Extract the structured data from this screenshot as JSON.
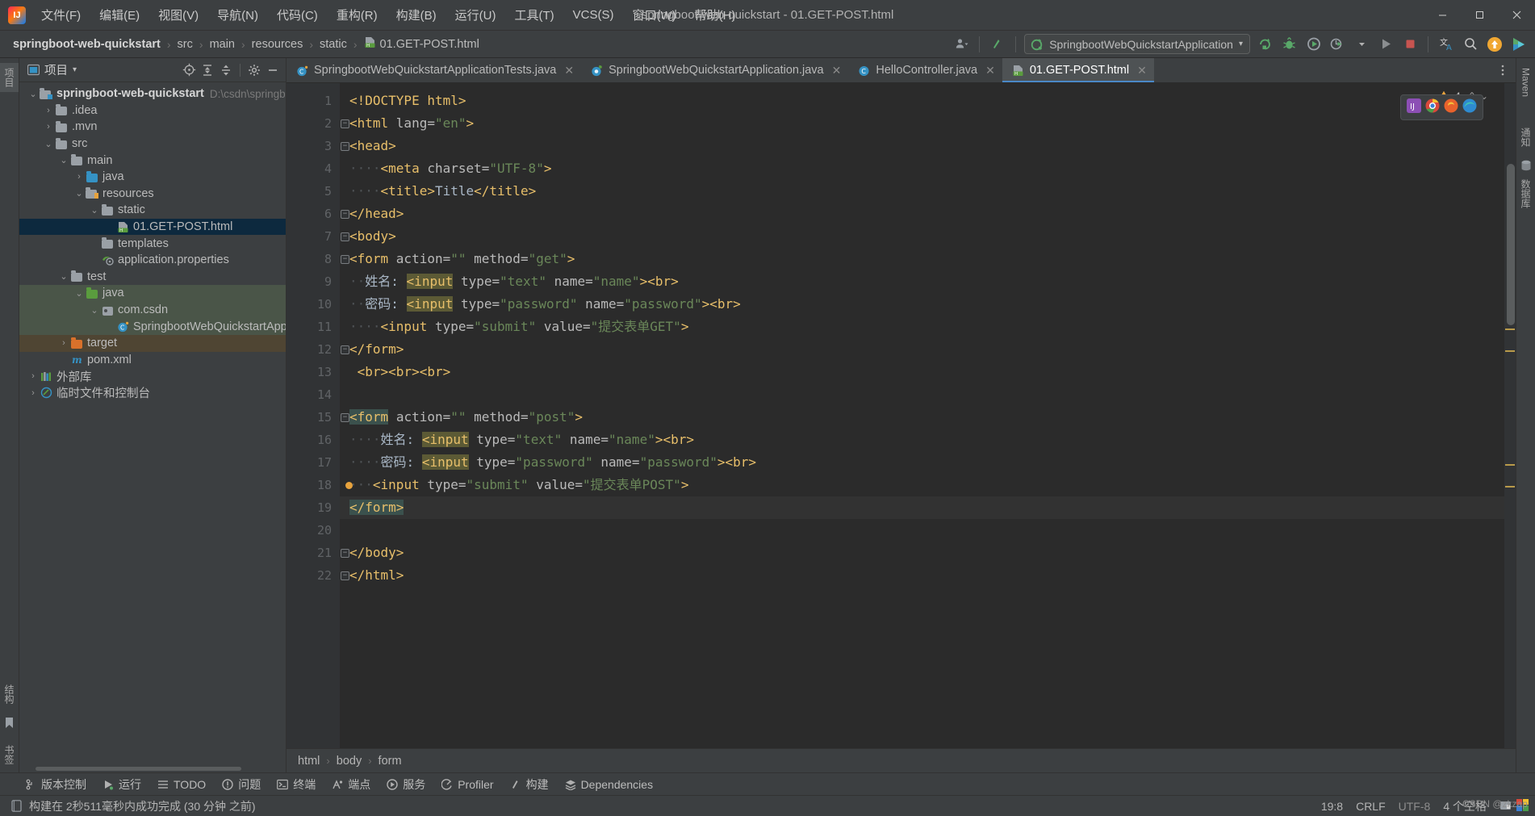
{
  "window": {
    "title": "springboot-web-quickstart - 01.GET-POST.html",
    "logo_text": "IJ",
    "controls": {
      "minimize": "—",
      "maximize": "☐",
      "close": "✕"
    }
  },
  "menubar": {
    "items": [
      {
        "label": "文件(F)",
        "name": "menu-file"
      },
      {
        "label": "编辑(E)",
        "name": "menu-edit"
      },
      {
        "label": "视图(V)",
        "name": "menu-view"
      },
      {
        "label": "导航(N)",
        "name": "menu-navigate"
      },
      {
        "label": "代码(C)",
        "name": "menu-code"
      },
      {
        "label": "重构(R)",
        "name": "menu-refactor"
      },
      {
        "label": "构建(B)",
        "name": "menu-build"
      },
      {
        "label": "运行(U)",
        "name": "menu-run"
      },
      {
        "label": "工具(T)",
        "name": "menu-tools"
      },
      {
        "label": "VCS(S)",
        "name": "menu-vcs"
      },
      {
        "label": "窗口(W)",
        "name": "menu-window"
      },
      {
        "label": "帮助(H)",
        "name": "menu-help"
      }
    ]
  },
  "navbar": {
    "breadcrumbs": [
      "springboot-web-quickstart",
      "src",
      "main",
      "resources",
      "static"
    ],
    "file": "01.GET-POST.html",
    "separator": "›",
    "run_config": "SpringbootWebQuickstartApplication",
    "run_config_caret": "▾"
  },
  "project_panel": {
    "title": "项目",
    "caret": "▾",
    "tree": [
      {
        "label": "springboot-web-quickstart",
        "path": "D:\\csdn\\springboo",
        "indent": 0,
        "arrow": "⌄",
        "icon": "module-folder",
        "bold": true,
        "state": "normal"
      },
      {
        "label": ".idea",
        "indent": 1,
        "arrow": "›",
        "icon": "folder-grey",
        "state": "normal"
      },
      {
        "label": ".mvn",
        "indent": 1,
        "arrow": "›",
        "icon": "folder-grey",
        "state": "normal"
      },
      {
        "label": "src",
        "indent": 1,
        "arrow": "⌄",
        "icon": "folder-grey",
        "state": "normal"
      },
      {
        "label": "main",
        "indent": 2,
        "arrow": "⌄",
        "icon": "folder-grey",
        "state": "normal"
      },
      {
        "label": "java",
        "indent": 3,
        "arrow": "›",
        "icon": "folder-blue",
        "state": "normal"
      },
      {
        "label": "resources",
        "indent": 3,
        "arrow": "⌄",
        "icon": "folder-resources",
        "state": "normal"
      },
      {
        "label": "static",
        "indent": 4,
        "arrow": "⌄",
        "icon": "folder-grey",
        "state": "normal"
      },
      {
        "label": "01.GET-POST.html",
        "indent": 5,
        "arrow": "",
        "icon": "html-file",
        "state": "selected"
      },
      {
        "label": "templates",
        "indent": 4,
        "arrow": "",
        "icon": "folder-grey",
        "state": "normal"
      },
      {
        "label": "application.properties",
        "indent": 4,
        "arrow": "",
        "icon": "spring-properties",
        "state": "normal"
      },
      {
        "label": "test",
        "indent": 2,
        "arrow": "⌄",
        "icon": "folder-grey",
        "state": "normal"
      },
      {
        "label": "java",
        "indent": 3,
        "arrow": "⌄",
        "icon": "folder-green",
        "state": "green"
      },
      {
        "label": "com.csdn",
        "indent": 4,
        "arrow": "⌄",
        "icon": "package",
        "state": "green"
      },
      {
        "label": "SpringbootWebQuickstartApplic",
        "indent": 5,
        "arrow": "",
        "icon": "java-test-class",
        "state": "green"
      },
      {
        "label": "target",
        "indent": 2,
        "arrow": "›",
        "icon": "folder-orange",
        "state": "brown"
      },
      {
        "label": "pom.xml",
        "indent": 2,
        "arrow": "",
        "icon": "maven-file",
        "state": "normal"
      },
      {
        "label": "外部库",
        "indent": 0,
        "arrow": "›",
        "icon": "library",
        "state": "normal"
      },
      {
        "label": "临时文件和控制台",
        "indent": 0,
        "arrow": "›",
        "icon": "scratches",
        "state": "normal"
      }
    ]
  },
  "left_strip": {
    "tabs": [
      "项目"
    ],
    "bottom": [
      "结构",
      "书签"
    ]
  },
  "right_strip": {
    "tabs": [
      "Maven",
      "通知",
      "数据库"
    ]
  },
  "editor_tabs": [
    {
      "label": "SpringbootWebQuickstartApplicationTests.java",
      "icon": "java-test-class",
      "active": false,
      "close": "✕"
    },
    {
      "label": "SpringbootWebQuickstartApplication.java",
      "icon": "spring-boot-class",
      "active": false,
      "close": "✕"
    },
    {
      "label": "HelloController.java",
      "icon": "java-class",
      "active": false,
      "close": "✕"
    },
    {
      "label": "01.GET-POST.html",
      "icon": "html-file",
      "active": true,
      "close": "✕"
    }
  ],
  "editor": {
    "warning_count": "4",
    "warning_icon": "warning-triangle",
    "chevron_up": "⌃",
    "chevron_down": "⌄",
    "lines": [
      {
        "n": 1,
        "tokens": [
          {
            "t": "<!DOCTYPE ",
            "c": "tagc"
          },
          {
            "t": "html>",
            "c": "tagc"
          }
        ],
        "indent": 0
      },
      {
        "n": 2,
        "tokens": [
          {
            "t": "<html ",
            "c": "tagc"
          },
          {
            "t": "lang=",
            "c": "attrn"
          },
          {
            "t": "\"en\"",
            "c": "attrv"
          },
          {
            "t": ">",
            "c": "tagc"
          }
        ],
        "fold": "open"
      },
      {
        "n": 3,
        "tokens": [
          {
            "t": "<head>",
            "c": "tagc"
          }
        ],
        "fold": "open"
      },
      {
        "n": 4,
        "tokens": [
          {
            "t": "····",
            "c": "dots"
          },
          {
            "t": "<meta ",
            "c": "tagc"
          },
          {
            "t": "charset=",
            "c": "attrn"
          },
          {
            "t": "\"UTF-8\"",
            "c": "attrv"
          },
          {
            "t": ">",
            "c": "tagc"
          }
        ]
      },
      {
        "n": 5,
        "tokens": [
          {
            "t": "····",
            "c": "dots"
          },
          {
            "t": "<title>",
            "c": "tagc"
          },
          {
            "t": "Title",
            "c": "txtc"
          },
          {
            "t": "</title>",
            "c": "tagc"
          }
        ]
      },
      {
        "n": 6,
        "tokens": [
          {
            "t": "</head>",
            "c": "tagc"
          }
        ],
        "fold": "close"
      },
      {
        "n": 7,
        "tokens": [
          {
            "t": "<body>",
            "c": "tagc"
          }
        ],
        "fold": "open"
      },
      {
        "n": 8,
        "tokens": [
          {
            "t": "<form ",
            "c": "tagc"
          },
          {
            "t": "action=",
            "c": "attrn"
          },
          {
            "t": "\"\"",
            "c": "attrv"
          },
          {
            "t": " ",
            "c": "attrn"
          },
          {
            "t": "method=",
            "c": "attrn"
          },
          {
            "t": "\"get\"",
            "c": "attrv"
          },
          {
            "t": ">",
            "c": "tagc"
          }
        ],
        "fold": "open"
      },
      {
        "n": 9,
        "tokens": [
          {
            "t": "··",
            "c": "dots"
          },
          {
            "t": "姓名:",
            "c": "cjk"
          },
          {
            "t": " ",
            "c": "txtc"
          },
          {
            "t": "<input",
            "c": "tagc hl-olive"
          },
          {
            "t": " ",
            "c": "attrn"
          },
          {
            "t": "type=",
            "c": "attrn"
          },
          {
            "t": "\"text\"",
            "c": "attrv"
          },
          {
            "t": " ",
            "c": "attrn"
          },
          {
            "t": "name=",
            "c": "attrn"
          },
          {
            "t": "\"name\"",
            "c": "attrv"
          },
          {
            "t": ">",
            "c": "tagc"
          },
          {
            "t": "<br>",
            "c": "tagc"
          }
        ]
      },
      {
        "n": 10,
        "tokens": [
          {
            "t": "··",
            "c": "dots"
          },
          {
            "t": "密码:",
            "c": "cjk"
          },
          {
            "t": " ",
            "c": "txtc"
          },
          {
            "t": "<input",
            "c": "tagc hl-olive"
          },
          {
            "t": " ",
            "c": "attrn"
          },
          {
            "t": "type=",
            "c": "attrn"
          },
          {
            "t": "\"password\"",
            "c": "attrv"
          },
          {
            "t": " ",
            "c": "attrn"
          },
          {
            "t": "name=",
            "c": "attrn"
          },
          {
            "t": "\"password\"",
            "c": "attrv"
          },
          {
            "t": ">",
            "c": "tagc"
          },
          {
            "t": "<br>",
            "c": "tagc"
          }
        ]
      },
      {
        "n": 11,
        "tokens": [
          {
            "t": "····",
            "c": "dots"
          },
          {
            "t": "<input ",
            "c": "tagc"
          },
          {
            "t": "type=",
            "c": "attrn"
          },
          {
            "t": "\"submit\"",
            "c": "attrv"
          },
          {
            "t": " ",
            "c": "attrn"
          },
          {
            "t": "value=",
            "c": "attrn"
          },
          {
            "t": "\"提交表单GET\"",
            "c": "attrv"
          },
          {
            "t": ">",
            "c": "tagc"
          }
        ]
      },
      {
        "n": 12,
        "tokens": [
          {
            "t": "</form>",
            "c": "tagc"
          }
        ],
        "fold": "close"
      },
      {
        "n": 13,
        "tokens": [
          {
            "t": " ",
            "c": "txtc"
          },
          {
            "t": "<br><br><br>",
            "c": "tagc"
          }
        ]
      },
      {
        "n": 14,
        "tokens": []
      },
      {
        "n": 15,
        "tokens": [
          {
            "t": "<form",
            "c": "tagc hl-teal"
          },
          {
            "t": " ",
            "c": "attrn"
          },
          {
            "t": "action=",
            "c": "attrn"
          },
          {
            "t": "\"\"",
            "c": "attrv"
          },
          {
            "t": " ",
            "c": "attrn"
          },
          {
            "t": "method=",
            "c": "attrn"
          },
          {
            "t": "\"post\"",
            "c": "attrv"
          },
          {
            "t": ">",
            "c": "tagc"
          }
        ],
        "fold": "open"
      },
      {
        "n": 16,
        "tokens": [
          {
            "t": "····",
            "c": "dots"
          },
          {
            "t": "姓名:",
            "c": "cjk"
          },
          {
            "t": " ",
            "c": "txtc"
          },
          {
            "t": "<input",
            "c": "tagc hl-olive"
          },
          {
            "t": " ",
            "c": "attrn"
          },
          {
            "t": "type=",
            "c": "attrn"
          },
          {
            "t": "\"text\"",
            "c": "attrv"
          },
          {
            "t": " ",
            "c": "attrn"
          },
          {
            "t": "name=",
            "c": "attrn"
          },
          {
            "t": "\"name\"",
            "c": "attrv"
          },
          {
            "t": ">",
            "c": "tagc"
          },
          {
            "t": "<br>",
            "c": "tagc"
          }
        ]
      },
      {
        "n": 17,
        "tokens": [
          {
            "t": "····",
            "c": "dots"
          },
          {
            "t": "密码:",
            "c": "cjk"
          },
          {
            "t": " ",
            "c": "txtc"
          },
          {
            "t": "<input",
            "c": "tagc hl-olive"
          },
          {
            "t": " ",
            "c": "attrn"
          },
          {
            "t": "type=",
            "c": "attrn"
          },
          {
            "t": "\"password\"",
            "c": "attrv"
          },
          {
            "t": " ",
            "c": "attrn"
          },
          {
            "t": "name=",
            "c": "attrn"
          },
          {
            "t": "\"password\"",
            "c": "attrv"
          },
          {
            "t": ">",
            "c": "tagc"
          },
          {
            "t": "<br>",
            "c": "tagc"
          }
        ]
      },
      {
        "n": 18,
        "tokens": [
          {
            "t": "···",
            "c": "dots"
          },
          {
            "t": "<input ",
            "c": "tagc"
          },
          {
            "t": "type=",
            "c": "attrn"
          },
          {
            "t": "\"submit\"",
            "c": "attrv"
          },
          {
            "t": " ",
            "c": "attrn"
          },
          {
            "t": "value=",
            "c": "attrn"
          },
          {
            "t": "\"提交表单POST\"",
            "c": "attrv"
          },
          {
            "t": ">",
            "c": "tagc"
          }
        ],
        "warn": true
      },
      {
        "n": 19,
        "tokens": [
          {
            "t": "</form>",
            "c": "tagc hl-teal"
          }
        ],
        "fold": "close",
        "current": true
      },
      {
        "n": 20,
        "tokens": []
      },
      {
        "n": 21,
        "tokens": [
          {
            "t": "</body>",
            "c": "tagc"
          }
        ],
        "fold": "close"
      },
      {
        "n": 22,
        "tokens": [
          {
            "t": "</html>",
            "c": "tagc"
          }
        ],
        "fold": "close"
      }
    ]
  },
  "editor_breadcrumb": {
    "items": [
      "html",
      "body",
      "form"
    ],
    "separator": "›"
  },
  "tool_windows": [
    {
      "label": "版本控制",
      "icon": "branch-icon",
      "name": "tool-version-control"
    },
    {
      "label": "运行",
      "icon": "run-icon",
      "name": "tool-run"
    },
    {
      "label": "TODO",
      "icon": "list-icon",
      "name": "tool-todo"
    },
    {
      "label": "问题",
      "icon": "error-icon",
      "name": "tool-problems"
    },
    {
      "label": "终端",
      "icon": "terminal-icon",
      "name": "tool-terminal"
    },
    {
      "label": "端点",
      "icon": "endpoints-icon",
      "name": "tool-endpoints"
    },
    {
      "label": "服务",
      "icon": "services-icon",
      "name": "tool-services"
    },
    {
      "label": "Profiler",
      "icon": "profiler-icon",
      "name": "tool-profiler"
    },
    {
      "label": "构建",
      "icon": "build-icon",
      "name": "tool-build"
    },
    {
      "label": "Dependencies",
      "icon": "dependencies-icon",
      "name": "tool-dependencies"
    }
  ],
  "statusbar": {
    "message": "构建在 2秒511毫秒内成功完成 (30 分钟 之前)",
    "message_icon": "build-status-icon",
    "caret_position": "19:8",
    "line_separator": "CRLF",
    "encoding": "UTF-8",
    "indent": "4 个空格",
    "watermark": "CSDN @zkzap"
  },
  "colors": {
    "accent_blue": "#4a88c7",
    "selection_blue": "#0d293e",
    "tag_orange": "#e8bf6a",
    "string_green": "#6a8759",
    "text_blue_grey": "#a9b7c6",
    "warn_amber": "#e8a33d",
    "green_run": "#59a869",
    "stop_red": "#c75450",
    "background": "#3c3f41",
    "editor_bg": "#2b2b2b"
  }
}
